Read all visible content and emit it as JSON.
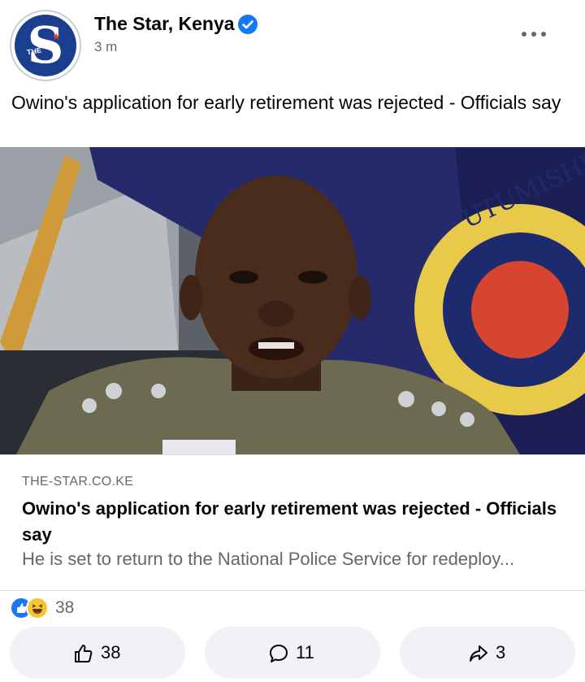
{
  "post": {
    "page_name": "The Star, Kenya",
    "time": "3 m",
    "text": "Owino's application for early retirement was rejected - Officials say",
    "avatar_letters": "S",
    "avatar_small": "THE"
  },
  "link": {
    "domain": "THE-STAR.CO.KE",
    "title": "Owino's application for early retirement was rejected - Officials say",
    "description": "He is set to return to the National Police Service for redeploy..."
  },
  "reactions": {
    "count": "38"
  },
  "actions": {
    "like_count": "38",
    "comment_count": "11",
    "share_count": "3"
  },
  "colors": {
    "accent": "#1877f2",
    "secondary_text": "#65676b",
    "button_bg": "#f0f2f5"
  }
}
